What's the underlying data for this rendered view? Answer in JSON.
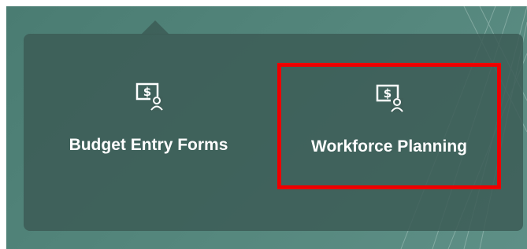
{
  "menu": {
    "items": [
      {
        "label": "Budget Entry Forms",
        "icon": "budget-user-icon",
        "highlighted": false
      },
      {
        "label": "Workforce Planning",
        "icon": "budget-user-icon",
        "highlighted": true
      }
    ]
  },
  "colors": {
    "backdrop": "#55877d",
    "popover": "#3c5c56",
    "text": "#ffffff",
    "highlight": "#ee0000"
  }
}
